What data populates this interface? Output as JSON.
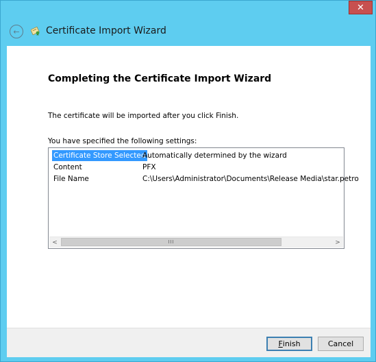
{
  "window": {
    "title": "Certificate Import Wizard",
    "close_glyph": "✕",
    "back_glyph": "←",
    "accent_color": "#5ecdf0"
  },
  "icons": {
    "back": "back-arrow-icon",
    "wizard": "certificate-icon",
    "close": "close-icon"
  },
  "page": {
    "heading": "Completing the Certificate Import Wizard",
    "info": "The certificate will be imported after you click Finish.",
    "settings_label": "You have specified the following settings:"
  },
  "settings": {
    "rows": [
      {
        "name": "Certificate Store Selected",
        "value": "Automatically determined by the wizard"
      },
      {
        "name": "Content",
        "value": "PFX"
      },
      {
        "name": "File Name",
        "value": "C:\\Users\\Administrator\\Documents\\Release Media\\star.petro"
      }
    ],
    "selected_row": 0,
    "scroll_left_glyph": "<",
    "scroll_right_glyph": ">",
    "scroll_grip_glyph": "III"
  },
  "buttons": {
    "finish_prefix": "F",
    "finish_rest": "inish",
    "cancel": "Cancel"
  }
}
